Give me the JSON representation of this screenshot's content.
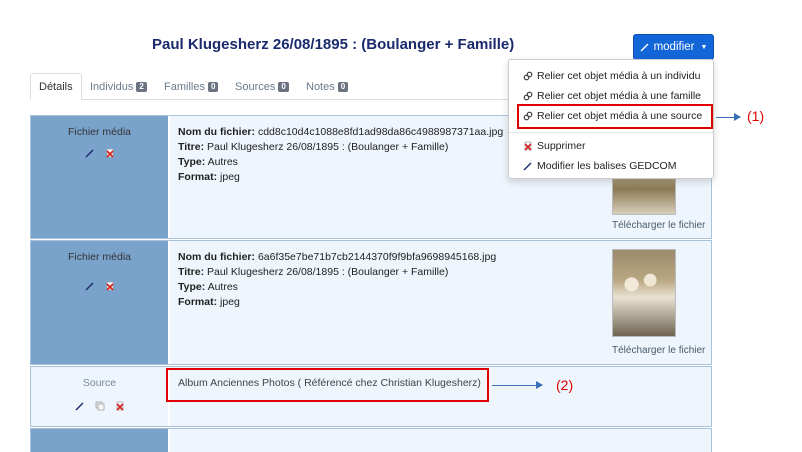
{
  "header": {
    "title": "Paul Klugesherz 26/08/1895 : (Boulanger + Famille)",
    "modifier_label": "modifier"
  },
  "tabs": [
    {
      "label": "Détails",
      "count": null
    },
    {
      "label": "Individus",
      "count": "2"
    },
    {
      "label": "Familles",
      "count": "0"
    },
    {
      "label": "Sources",
      "count": "0"
    },
    {
      "label": "Notes",
      "count": "0"
    }
  ],
  "dropdown": {
    "items": [
      {
        "label": "Relier cet objet média à un individu",
        "icon": "link-icon"
      },
      {
        "label": "Relier cet objet média à une famille",
        "icon": "link-icon"
      },
      {
        "label": "Relier cet objet média à une source",
        "icon": "link-icon"
      },
      {
        "label": "Supprimer",
        "icon": "delete-icon"
      },
      {
        "label": "Modifier les balises GEDCOM",
        "icon": "pencil-icon"
      }
    ]
  },
  "media": [
    {
      "section_label": "Fichier média",
      "filename_label": "Nom du fichier:",
      "filename": "cdd8c10d4c1088e8fd1ad98da86c4988987371aa.jpg",
      "title_label": "Titre:",
      "title": "Paul Klugesherz 26/08/1895 : (Boulanger + Famille)",
      "type_label": "Type:",
      "type": "Autres",
      "format_label": "Format:",
      "format": "jpeg",
      "download_label": "Télécharger le fichier"
    },
    {
      "section_label": "Fichier média",
      "filename_label": "Nom du fichier:",
      "filename": "6a6f35e7be71b7cb2144370f9f9bfa9698945168.jpg",
      "title_label": "Titre:",
      "title": "Paul Klugesherz 26/08/1895 : (Boulanger + Famille)",
      "type_label": "Type:",
      "type": "Autres",
      "format_label": "Format:",
      "format": "jpeg",
      "download_label": "Télécharger le fichier"
    }
  ],
  "source": {
    "section_label": "Source",
    "text": "Album Anciennes Photos ( Référencé chez Christian Klugesherz)"
  },
  "annotations": {
    "one": "(1)",
    "two": "(2)"
  },
  "colors": {
    "accent": "#1266d8",
    "label_column": "#7aa3cc",
    "content_bg": "#eef5fc",
    "highlight": "#e00000",
    "title": "#1a2a6c"
  }
}
